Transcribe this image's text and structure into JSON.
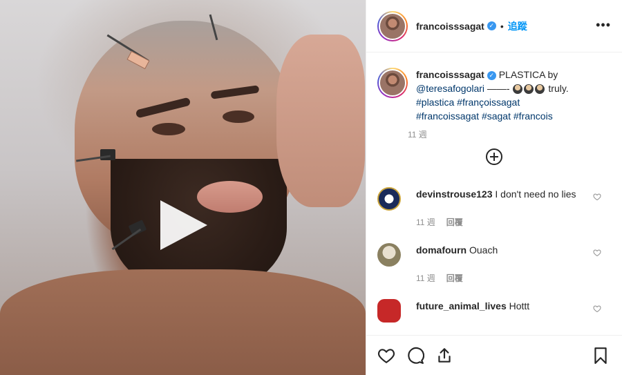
{
  "post": {
    "username": "francoisssagat",
    "verified_mark": "✓",
    "separator": "•",
    "follow_label": "追蹤",
    "more_label": "•••",
    "video": {
      "play_icon": "play-icon"
    }
  },
  "caption": {
    "username": "francoisssagat",
    "text_1": " PLASTICA by ",
    "mention": "@teresafogolari",
    "text_2": " ——- ",
    "text_3": " truly. ",
    "tags": [
      "#plastica",
      "#françoissagat",
      "#francoissagat",
      "#sagat",
      "#francois"
    ],
    "time": "11 週"
  },
  "comments": [
    {
      "username": "devinstrouse123",
      "text": " I don't need no lies",
      "time": "11 週",
      "reply": "回覆"
    },
    {
      "username": "domafourn",
      "text": " Ouach",
      "time": "11 週",
      "reply": "回覆"
    },
    {
      "username": "future_animal_lives",
      "text": " Hottt",
      "time": "",
      "reply": ""
    }
  ],
  "icons": {
    "like": "heart-icon",
    "comment": "comment-bubble-icon",
    "share": "share-icon",
    "save": "bookmark-icon",
    "load_more": "plus-circle-icon"
  },
  "colors": {
    "accent": "#0095f6",
    "verified": "#3897f0",
    "text": "#262626",
    "muted": "#8e8e8e",
    "link": "#00376b"
  }
}
